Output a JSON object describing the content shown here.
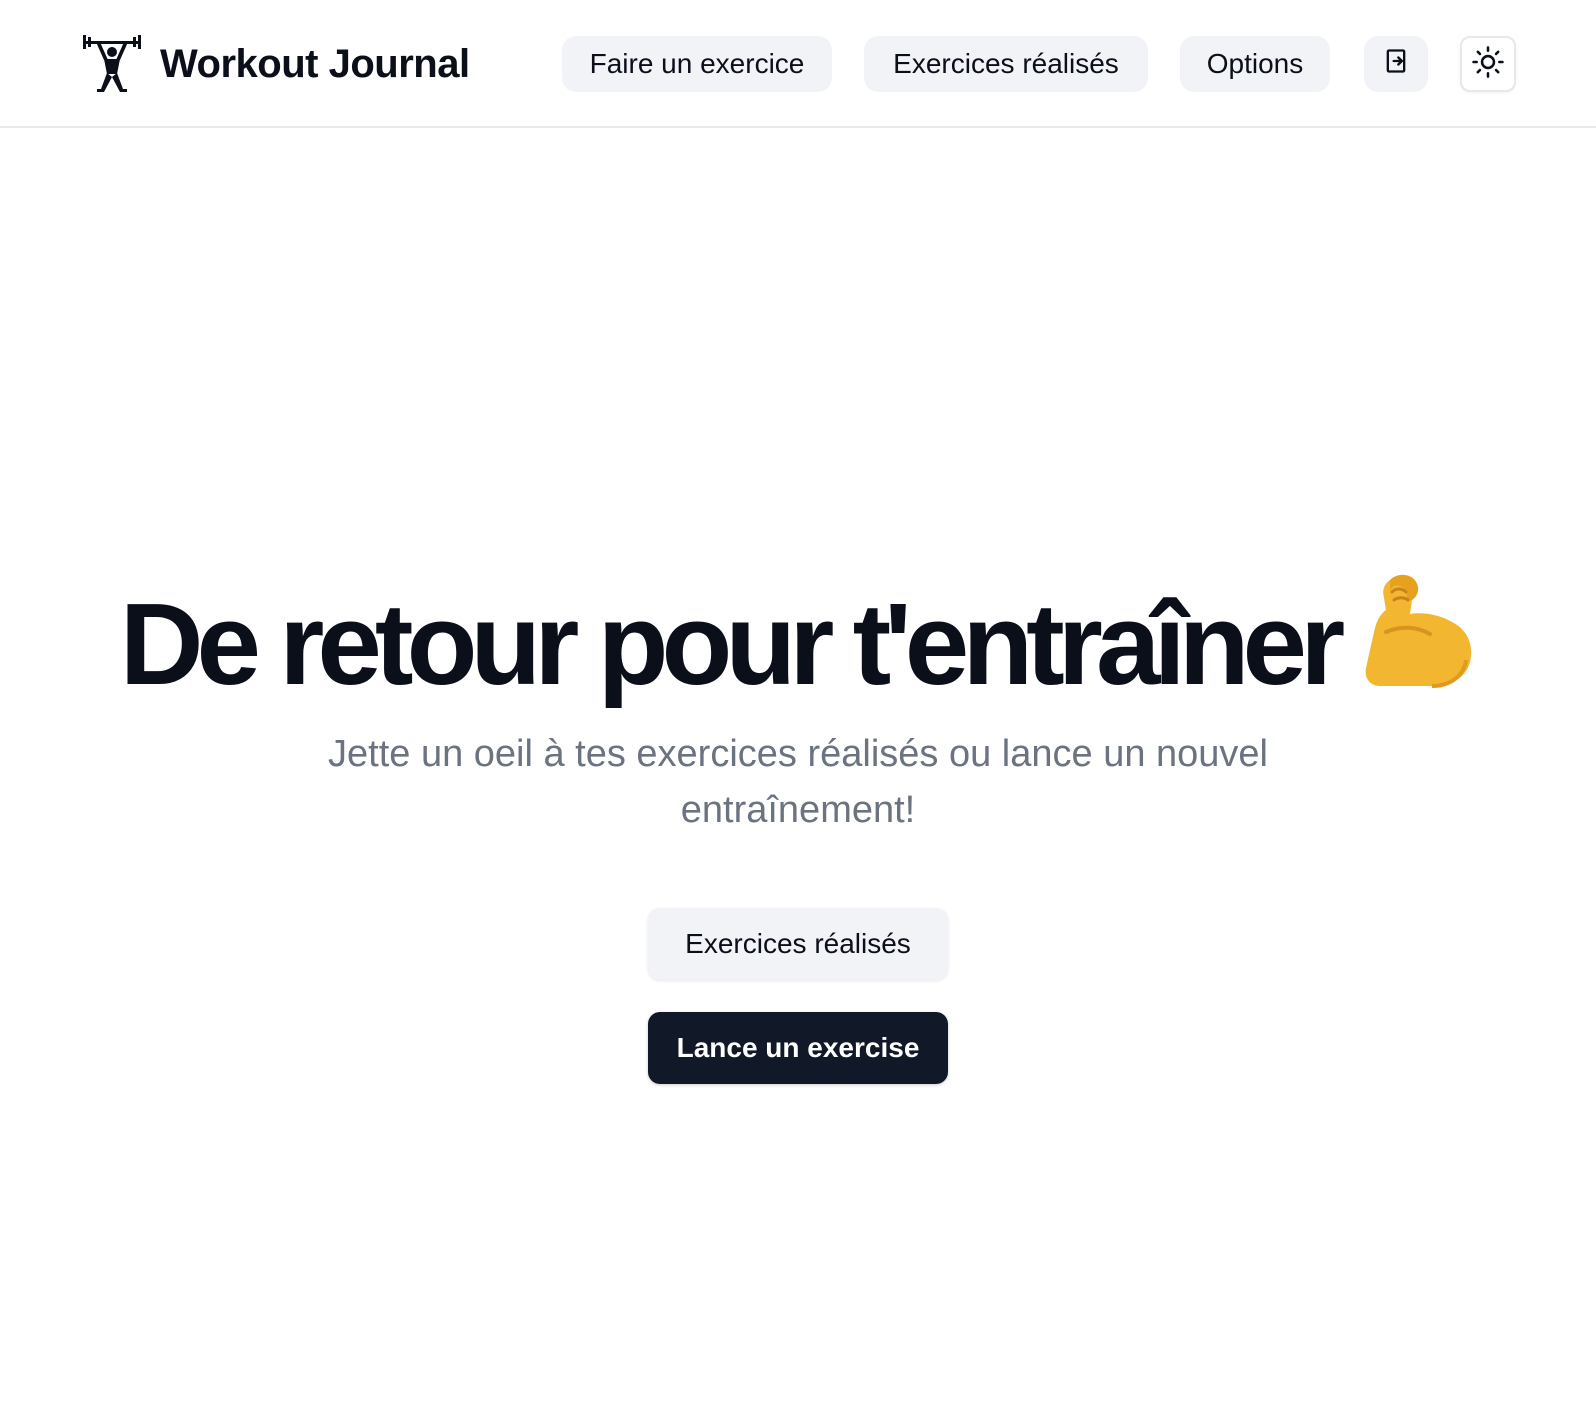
{
  "header": {
    "brand": {
      "title": "Workout Journal",
      "logo_icon": "weightlifter-icon"
    },
    "nav": [
      {
        "label": "Faire un exercice"
      },
      {
        "label": "Exercices réalisés"
      },
      {
        "label": "Options"
      }
    ],
    "logout_icon": "logout-door-icon",
    "theme_icon": "sun-icon"
  },
  "hero": {
    "title": "De retour pour t'entraîner",
    "emoji": "💪",
    "subtitle": "Jette un oeil à tes exercices réalisés ou lance un nouvel entraînement!",
    "secondary_button": "Exercices réalisés",
    "primary_button": "Lance un exercise"
  },
  "colors": {
    "text_primary": "#0b0f1a",
    "text_muted": "#6b7280",
    "button_light": "#f1f3f6",
    "button_dark": "#111827",
    "border": "#e6e8ec"
  }
}
